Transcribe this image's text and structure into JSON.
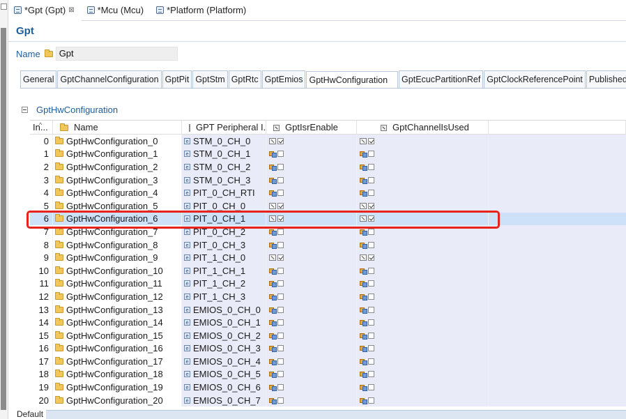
{
  "editor_tabs": [
    {
      "label": "*Gpt (Gpt)",
      "close": "⊠"
    },
    {
      "label": "*Mcu (Mcu)"
    },
    {
      "label": "*Platform (Platform)"
    }
  ],
  "page": {
    "title": "Gpt",
    "name_label": "Name",
    "name_value": "Gpt"
  },
  "config_tabs": [
    "General",
    "GptChannelConfiguration",
    "GptPit",
    "GptStm",
    "GptRtc",
    "GptEmios",
    "GptHwConfiguration",
    "GptEcucPartitionRef",
    "GptClockReferencePoint",
    "Published In"
  ],
  "section": {
    "title": "GptHwConfiguration"
  },
  "table": {
    "headers": {
      "index": "In...",
      "name": "Name",
      "peripheral": "GPT Peripheral I...",
      "isr_enable": "GptIsrEnable",
      "channel_used": "GptChannelIsUsed"
    },
    "selected_index": 6,
    "rows": [
      {
        "index": "0",
        "name": "GptHwConfiguration_0",
        "peripheral": "STM_0_CH_0",
        "isr": true,
        "used": true
      },
      {
        "index": "1",
        "name": "GptHwConfiguration_1",
        "peripheral": "STM_0_CH_1",
        "isr": false,
        "used": false
      },
      {
        "index": "2",
        "name": "GptHwConfiguration_2",
        "peripheral": "STM_0_CH_2",
        "isr": false,
        "used": false
      },
      {
        "index": "3",
        "name": "GptHwConfiguration_3",
        "peripheral": "STM_0_CH_3",
        "isr": false,
        "used": false
      },
      {
        "index": "4",
        "name": "GptHwConfiguration_4",
        "peripheral": "PIT_0_CH_RTI",
        "isr": false,
        "used": false
      },
      {
        "index": "5",
        "name": "GptHwConfiguration_5",
        "peripheral": "PIT_0_CH_0",
        "isr": true,
        "used": true
      },
      {
        "index": "6",
        "name": "GptHwConfiguration_6",
        "peripheral": "PIT_0_CH_1",
        "isr": true,
        "used": true
      },
      {
        "index": "7",
        "name": "GptHwConfiguration_7",
        "peripheral": "PIT_0_CH_2",
        "isr": false,
        "used": false
      },
      {
        "index": "8",
        "name": "GptHwConfiguration_8",
        "peripheral": "PIT_0_CH_3",
        "isr": false,
        "used": false
      },
      {
        "index": "9",
        "name": "GptHwConfiguration_9",
        "peripheral": "PIT_1_CH_0",
        "isr": true,
        "used": true
      },
      {
        "index": "10",
        "name": "GptHwConfiguration_10",
        "peripheral": "PIT_1_CH_1",
        "isr": false,
        "used": false
      },
      {
        "index": "11",
        "name": "GptHwConfiguration_11",
        "peripheral": "PIT_1_CH_2",
        "isr": false,
        "used": false
      },
      {
        "index": "12",
        "name": "GptHwConfiguration_12",
        "peripheral": "PIT_1_CH_3",
        "isr": false,
        "used": false
      },
      {
        "index": "13",
        "name": "GptHwConfiguration_13",
        "peripheral": "EMIOS_0_CH_0",
        "isr": false,
        "used": false
      },
      {
        "index": "14",
        "name": "GptHwConfiguration_14",
        "peripheral": "EMIOS_0_CH_1",
        "isr": false,
        "used": false
      },
      {
        "index": "15",
        "name": "GptHwConfiguration_15",
        "peripheral": "EMIOS_0_CH_2",
        "isr": false,
        "used": false
      },
      {
        "index": "16",
        "name": "GptHwConfiguration_16",
        "peripheral": "EMIOS_0_CH_3",
        "isr": false,
        "used": false
      },
      {
        "index": "17",
        "name": "GptHwConfiguration_17",
        "peripheral": "EMIOS_0_CH_4",
        "isr": false,
        "used": false
      },
      {
        "index": "18",
        "name": "GptHwConfiguration_18",
        "peripheral": "EMIOS_0_CH_5",
        "isr": false,
        "used": false
      },
      {
        "index": "19",
        "name": "GptHwConfiguration_19",
        "peripheral": "EMIOS_0_CH_6",
        "isr": false,
        "used": false
      },
      {
        "index": "20",
        "name": "GptHwConfiguration_20",
        "peripheral": "EMIOS_0_CH_7",
        "isr": false,
        "used": false
      }
    ]
  },
  "footer": {
    "default_label": "Default"
  },
  "colors": {
    "accent": "#1d5d9b",
    "highlight": "#e8231d",
    "selected_row": "#cde1f9",
    "cell_bg": "#e9ecf8"
  },
  "icons": {
    "editor_tab": "config-file-icon",
    "row": "folder-icon",
    "peripheral": "enum-icon",
    "default_value": "default-value-icon",
    "user_set_value": "user-set-value-icon"
  }
}
